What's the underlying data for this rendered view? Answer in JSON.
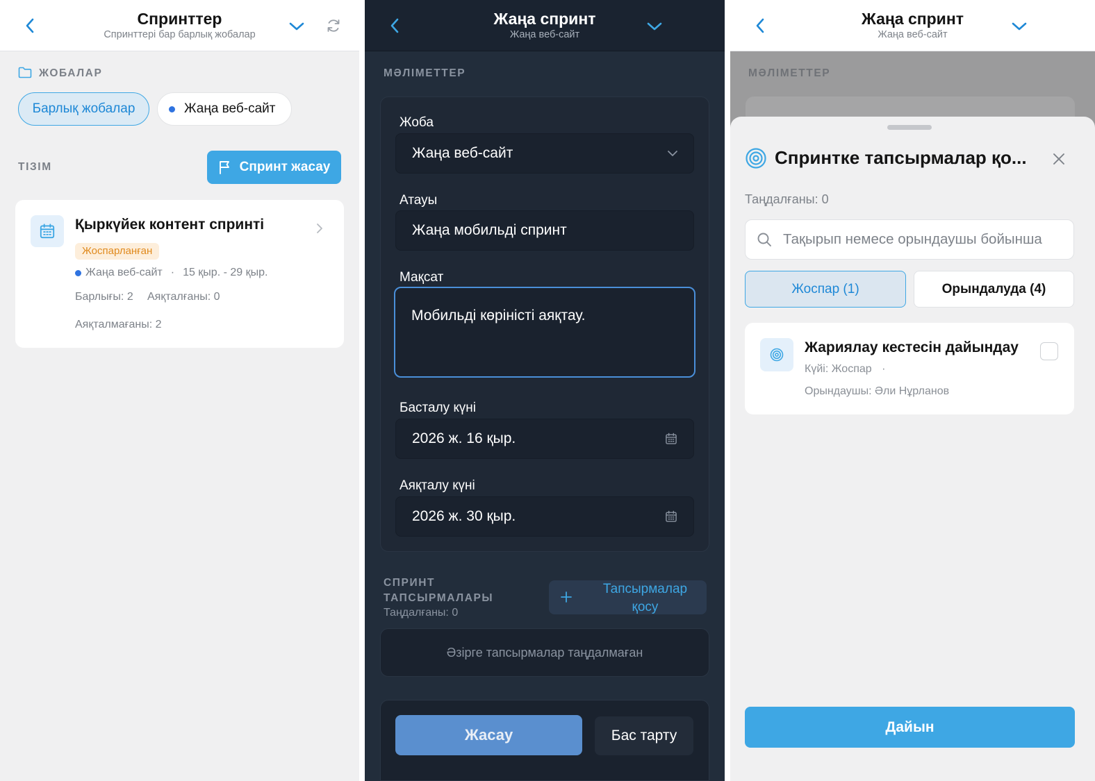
{
  "screen1": {
    "header": {
      "title": "Спринттер",
      "subtitle": "Спринттері бар барлық жобалар"
    },
    "projects_label": "ЖОБАЛАР",
    "chips": {
      "all": "Барлық жобалар",
      "project": "Жаңа веб-сайт"
    },
    "list_label": "ТІЗІМ",
    "create_button": "Спринт жасау",
    "sprint_card": {
      "title": "Қыркүйек контент спринті",
      "status": "Жоспарланған",
      "project": "Жаңа веб-сайт",
      "dates": "15 қыр. - 29 қыр.",
      "total": "Барлығы: 2",
      "done": "Аяқталғаны: 0",
      "not_done": "Аяқталмағаны: 2"
    }
  },
  "screen2": {
    "header": {
      "title": "Жаңа спринт",
      "subtitle": "Жаңа веб-сайт"
    },
    "details_label": "МӘЛІМЕТТЕР",
    "project": {
      "label": "Жоба",
      "value": "Жаңа веб-сайт"
    },
    "name": {
      "label": "Атауы",
      "value": "Жаңа мобильді спринт"
    },
    "goal": {
      "label": "Мақсат",
      "value": "Мобильді көріністі аяқтау."
    },
    "start": {
      "label": "Басталу күні",
      "value": "2026 ж. 16 қыр."
    },
    "end": {
      "label": "Аяқталу күні",
      "value": "2026 ж. 30 қыр."
    },
    "tasks": {
      "title_line1": "СПРИНТ",
      "title_line2": "ТАПСЫРМАЛАРЫ",
      "selected": "Таңдалғаны: 0",
      "add_line1": "Тапсырмалар",
      "add_line2": "қосу",
      "empty": "Әзірге тапсырмалар таңдалмаған"
    },
    "create_button": "Жасау",
    "cancel_button": "Бас тарту"
  },
  "screen3": {
    "header": {
      "title": "Жаңа спринт",
      "subtitle": "Жаңа веб-сайт"
    },
    "details_label": "МӘЛІМЕТТЕР",
    "sheet": {
      "title": "Спринтке тапсырмалар қо...",
      "selected": "Таңдалғаны: 0",
      "search_placeholder": "Тақырып немесе орындаушы бойынша",
      "tabs": {
        "plan": "Жоспар (1)",
        "in_progress": "Орындалуда (4)"
      },
      "task": {
        "title": "Жариялау кестесін дайындау",
        "status": "Күйі: Жоспар",
        "assignee": "Орындаушы: Әли Нұрланов"
      },
      "done_button": "Дайын"
    }
  },
  "colors": {
    "accent": "#3ea7e4",
    "accent_dark_text": "#1e88d6",
    "dark_bg": "#222d3b",
    "dark_panel": "#1a222e",
    "status_badge_bg": "#fdeedb",
    "status_badge_text": "#e08a1e",
    "project_dot": "#2f73e0",
    "create_button_muted": "#5a8fcf"
  },
  "icons": [
    "chevron-left-icon",
    "chevron-down-icon",
    "refresh-icon",
    "folder-icon",
    "flag-icon",
    "calendar-icon",
    "chevron-right-icon",
    "plus-icon",
    "target-icon",
    "close-icon",
    "search-icon",
    "checkbox-icon"
  ]
}
